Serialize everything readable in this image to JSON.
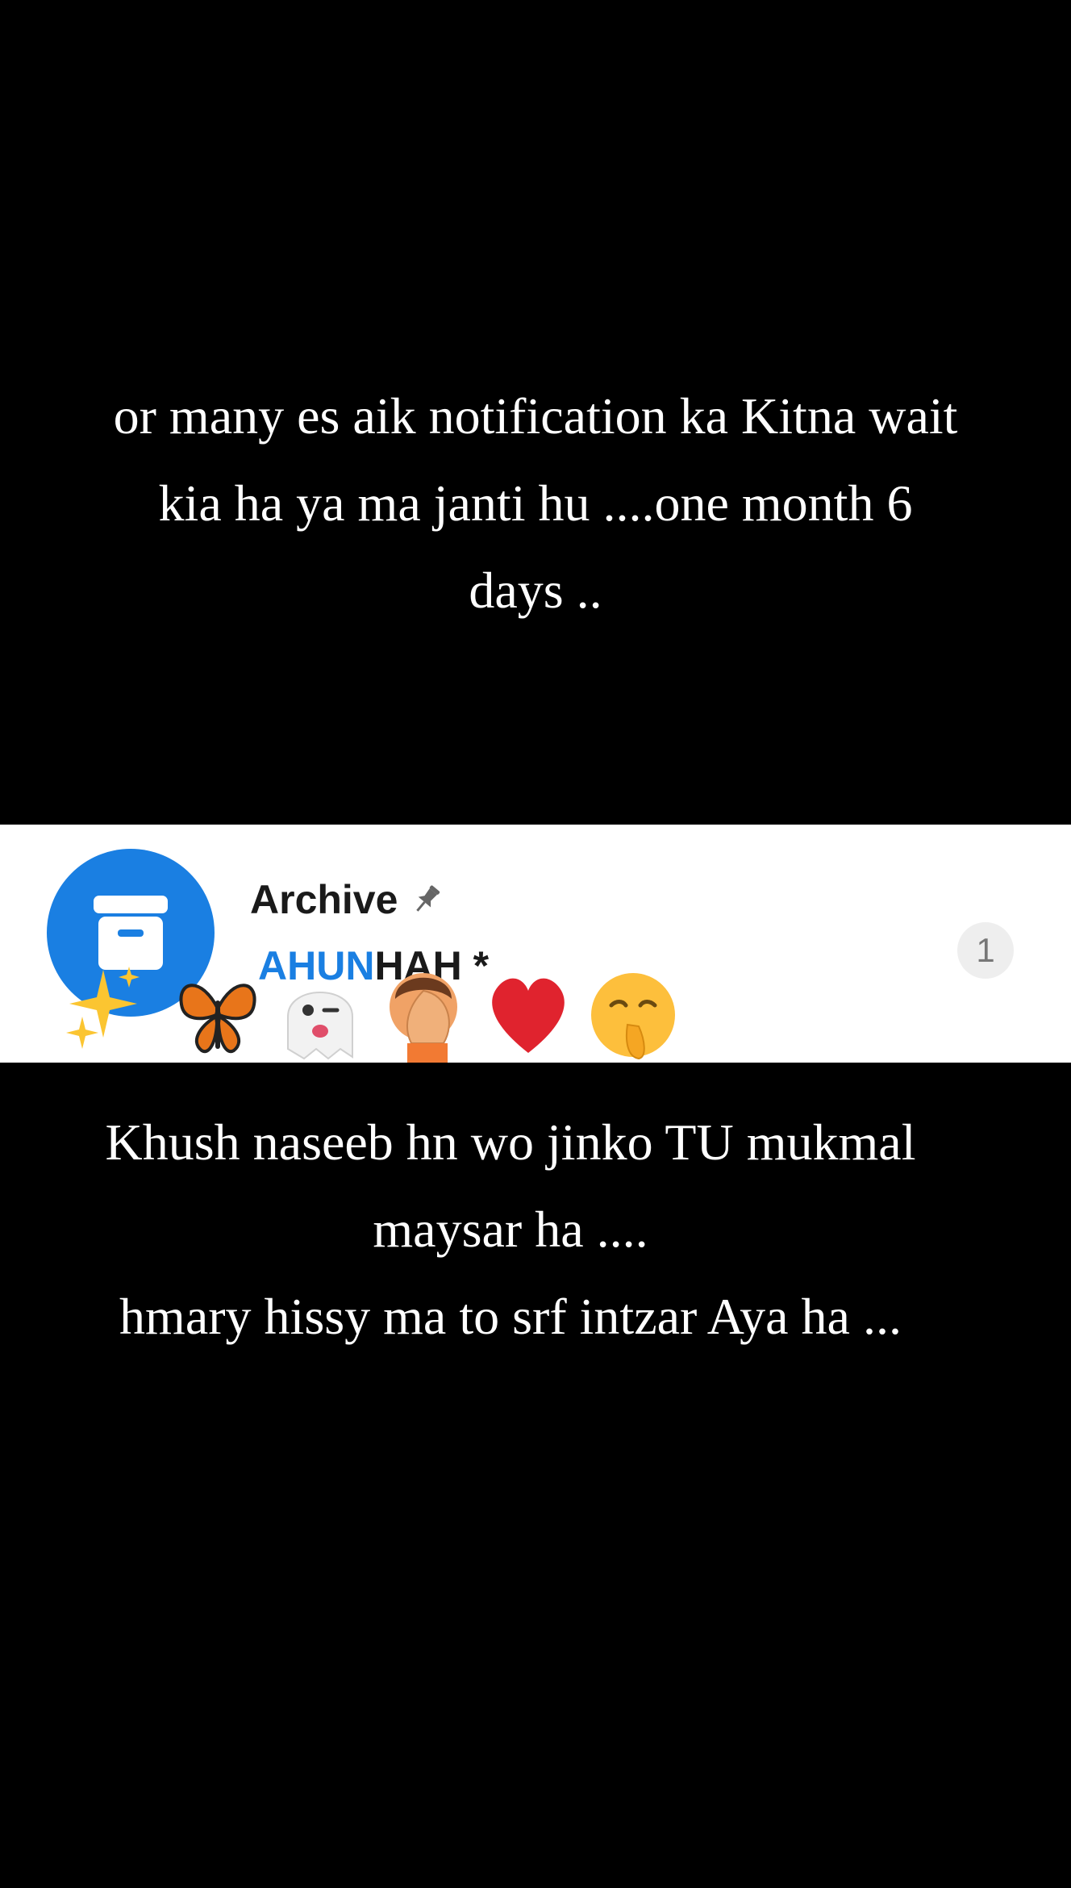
{
  "top_caption": {
    "lines": [
      "or many es aik notification ka Kitna wait",
      "kia ha ya ma janti hu ....one month 6",
      "days .."
    ]
  },
  "archive_row": {
    "title": "Archive",
    "title_icon": "pin-icon",
    "avatar_icon": "archive-box-icon",
    "preview_text_visible": "AHUN",
    "preview_text_end": "HAH *",
    "unread_count": "1",
    "avatar_color": "#1a7fe2",
    "emojis": [
      "sparkles",
      "butterfly",
      "ghost",
      "winking-tongue-face",
      "face-palm",
      "red-heart",
      "shushing-face"
    ]
  },
  "bottom_caption": {
    "lines": [
      "Khush naseeb hn wo jinko TU mukmal",
      "maysar ha ....",
      "hmary hissy ma to srf intzar Aya ha ..."
    ]
  },
  "colors": {
    "background": "#000000",
    "caption_text": "#ffffff",
    "card_background": "#ffffff",
    "accent_blue": "#1a7fe2"
  }
}
